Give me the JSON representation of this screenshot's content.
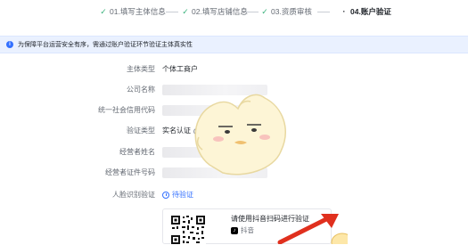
{
  "steps": [
    {
      "mark": "✓",
      "label": "01.填写主体信息"
    },
    {
      "mark": "✓",
      "label": "02.填写店铺信息"
    },
    {
      "mark": "✓",
      "label": "03.资质审核"
    },
    {
      "mark": "·",
      "label": "04.账户验证"
    }
  ],
  "notice": {
    "icon": "info-icon",
    "text": "为保障平台运营安全有序，需通过账户验证环节验证主体真实性"
  },
  "form": {
    "subject_type": {
      "label": "主体类型",
      "value": "个体工商户"
    },
    "company_name": {
      "label": "公司名称"
    },
    "credit_code": {
      "label": "统一社会信用代码"
    },
    "verify_type": {
      "label": "验证类型",
      "value": "实名认证"
    },
    "operator_name": {
      "label": "经营者姓名"
    },
    "operator_id": {
      "label": "经营者证件号码"
    },
    "face_verify": {
      "label": "人脸识别验证",
      "status": "待验证"
    }
  },
  "qr": {
    "title": "请使用抖音扫码进行验证",
    "app_name": "抖音",
    "app_icon": "tiktok-icon"
  },
  "colors": {
    "accent": "#3370ff",
    "success": "#3ab27c",
    "notice_bg": "#eaf1ff"
  }
}
